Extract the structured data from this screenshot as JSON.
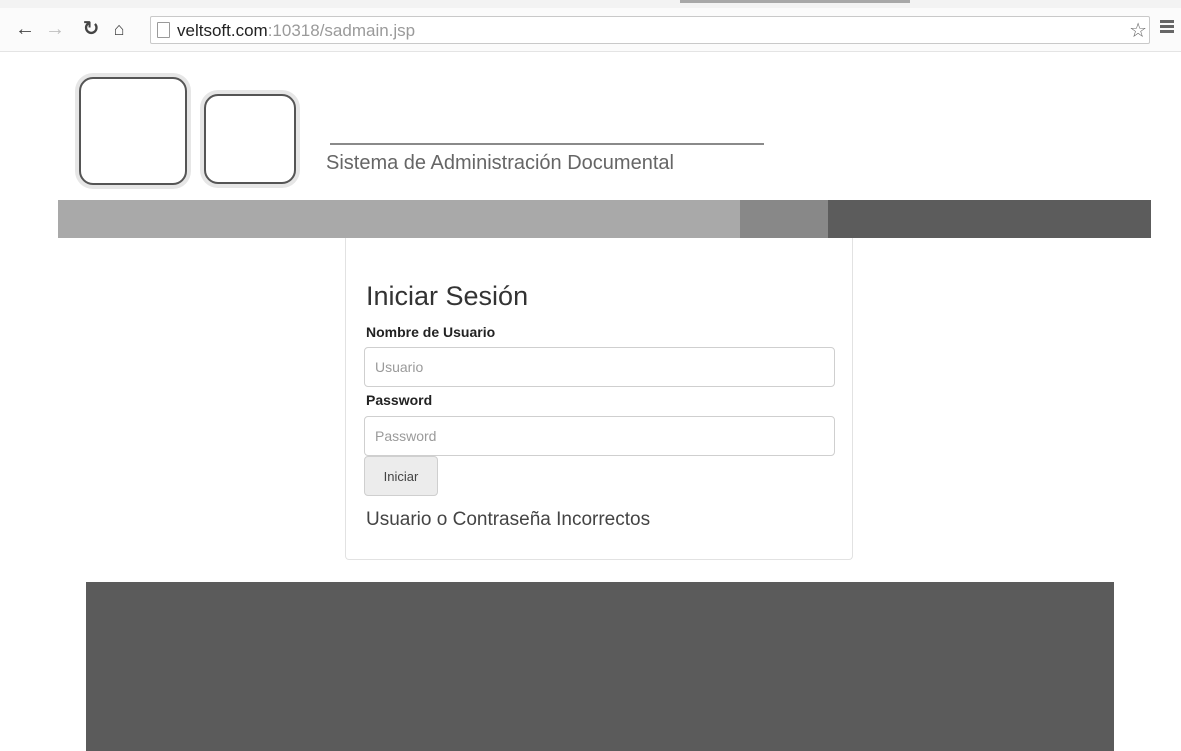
{
  "browser": {
    "url_host": "veltsoft.com",
    "url_path": ":10318/sadmain.jsp",
    "icons": {
      "back": "arrow-left-icon",
      "forward": "arrow-right-icon",
      "reload": "reload-icon",
      "home": "home-icon",
      "page": "page-icon",
      "bookmark": "star-icon",
      "menu": "hamburger-menu-icon"
    }
  },
  "header": {
    "system_title": "Sistema de Administración Documental"
  },
  "login": {
    "title": "Iniciar Sesión",
    "username_label": "Nombre de Usuario",
    "username_placeholder": "Usuario",
    "username_value": "",
    "password_label": "Password",
    "password_placeholder": "Password",
    "password_value": "",
    "submit_label": "Iniciar",
    "error_message": "Usuario o Contraseña Incorrectos"
  },
  "colors": {
    "band_light": "#a9a9a9",
    "band_mid": "#888888",
    "band_dark": "#5c5c5c",
    "footer": "#5b5b5b"
  }
}
